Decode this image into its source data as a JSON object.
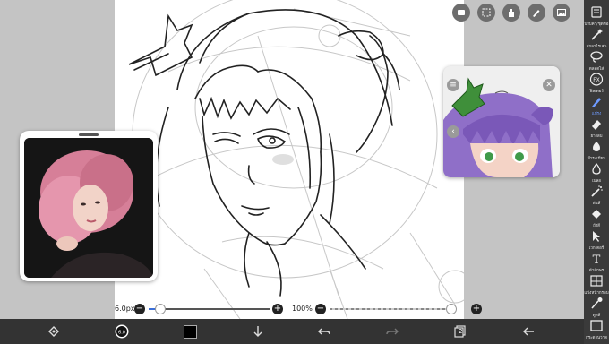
{
  "colors": {
    "accent": "#6f9bff",
    "toolbar_bg": "#3a3a3a",
    "bottom_bar_bg": "#333333",
    "canvas_bg": "#c4c4c4",
    "current_color": "#000000"
  },
  "top_tools": [
    "layer-settings-icon",
    "selection-icon",
    "hand-icon",
    "pen-tool-icon",
    "image-icon"
  ],
  "right_toolbar": {
    "tools": [
      {
        "icon": "settings-icon",
        "label": "ปรับค่า/ชุดข้อ",
        "active": false
      },
      {
        "icon": "magic-wand-icon",
        "label": "สกลาไรเสน",
        "active": false
      },
      {
        "icon": "lasso-icon",
        "label": "ตลอดไส่",
        "active": false
      },
      {
        "icon": "fx-icon",
        "label": "ฟิลเตอร์",
        "active": false
      },
      {
        "icon": "brush-icon",
        "label": "แปรง",
        "active": true
      },
      {
        "icon": "eraser-icon",
        "label": "ยางลบ",
        "active": false
      },
      {
        "icon": "smudge-icon",
        "label": "ทำระเบียน",
        "active": false
      },
      {
        "icon": "blur-icon",
        "label": "เบลอ",
        "active": false
      },
      {
        "icon": "spray-icon",
        "label": "พ่นสี",
        "active": false
      },
      {
        "icon": "fill-icon",
        "label": "ถังสี",
        "active": false
      },
      {
        "icon": "select-icon",
        "label": "เวกเตอร์",
        "active": false
      },
      {
        "icon": "text-icon",
        "label": "ตัวอักษร",
        "active": false
      },
      {
        "icon": "frame-icon",
        "label": "แบ่งหน้ากรอบ",
        "active": false
      },
      {
        "icon": "eyedropper-icon",
        "label": "ดูดสี",
        "active": false
      },
      {
        "icon": "canvas-icon",
        "label": "กระดานวาด",
        "active": false
      }
    ]
  },
  "slider_bar": {
    "brush_size": "6.0px",
    "brush_size_fraction": 0.05,
    "opacity": "100%",
    "opacity_fraction": 1.0,
    "minus": "−",
    "plus": "+"
  },
  "bottom_toolbar": {
    "items": [
      "transform-icon",
      "brush-preview-icon",
      "color-swatch",
      "move-down-icon",
      "undo-icon",
      "redo-icon",
      "layers-icon",
      "back-icon"
    ],
    "layer_count": "2"
  },
  "reference_window": {
    "content": "photo"
  },
  "preview_window": {
    "content": "colored-preview"
  }
}
